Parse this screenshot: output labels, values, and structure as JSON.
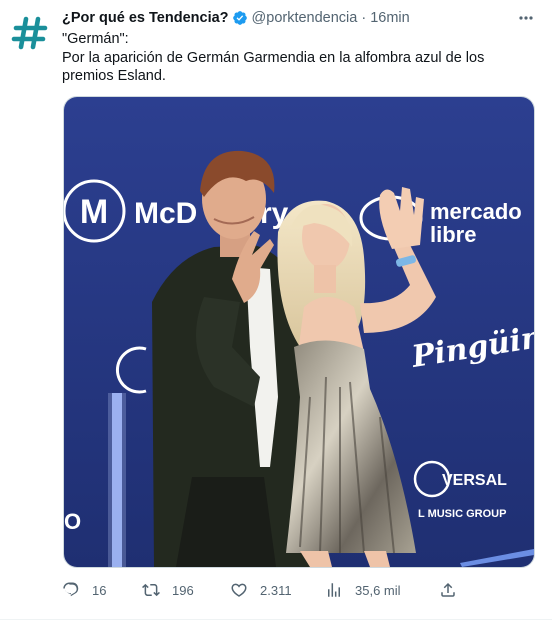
{
  "tweet": {
    "display_name": "¿Por qué es Tendencia?",
    "handle": "@porktendencia",
    "separator": "·",
    "time": "16min",
    "verified_color": "#1d9bf0",
    "avatar_icon": "hashtag-icon",
    "avatar_color": "#1a8f9a",
    "lines": [
      "\"Germán\":",
      "Por la aparición de Germán Garmendia en la alfombra azul de los premios Esland."
    ]
  },
  "media": {
    "backdrop_color": "#2a3e8c",
    "logos": {
      "mcdonalds_mark": "M",
      "mcdonalds_text": "McD",
      "mcdonalds_text_tail": "ry",
      "mercado_line1": "mercado",
      "mercado_line2": "libre",
      "pinguinos": "Pingüinos",
      "universal_text": "VERSAL",
      "universal_sub": "L MUSIC GROUP",
      "left_edge_letter": "O"
    }
  },
  "actions": {
    "replies": "16",
    "retweets": "196",
    "likes": "2.311",
    "views": "35,6 mil"
  }
}
